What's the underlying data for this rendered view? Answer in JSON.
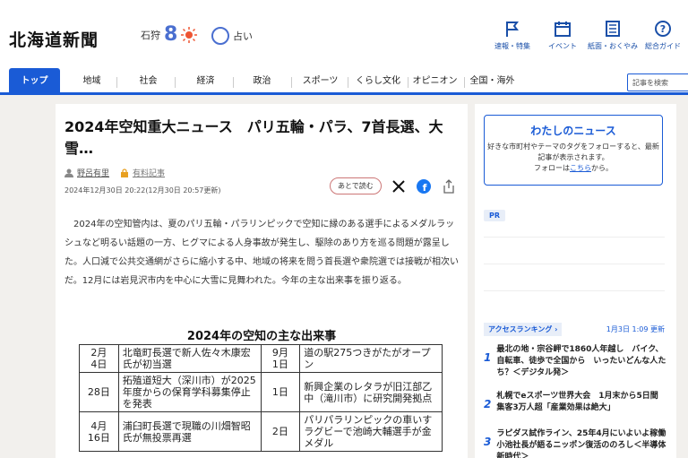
{
  "header": {
    "logo": "北海道新聞",
    "region": "石狩",
    "temp": "8",
    "fortune": "占い",
    "links": [
      "速報・特集",
      "イベント",
      "紙面・おくやみ",
      "総合ガイド"
    ]
  },
  "nav": {
    "items": [
      "トップ",
      "地域",
      "社会",
      "経済",
      "政治",
      "スポーツ",
      "くらし文化",
      "オピニオン",
      "全国・海外"
    ],
    "search_placeholder": "記事を検索"
  },
  "article": {
    "title": "2024年空知重大ニュース　パリ五輪・パラ、7首長選、大雪…",
    "author": "野呂有里",
    "paid": "有料記事",
    "date": "2024年12月30日 20:22(12月30日 20:57更新)",
    "later": "あとで読む",
    "body": "2024年の空知管内は、夏のパリ五輪・パラリンピックで空知に縁のある選手によるメダルラッシュなど明るい話題の一方、ヒグマによる人身事故が発生し、駆除のあり方を巡る問題が露呈した。人口減で公共交通網がさらに縮小する中、地域の将来を問う首長選や衆院選では接戦が相次いだ。12月には岩見沢市内を中心に大雪に見舞われた。今年の主な出来事を振り返る。",
    "table_title": "2024年の空知の主な出来事",
    "rows": [
      {
        "d1": "2月\n4日",
        "e1": "北竜町長選で新人佐々木康宏氏が初当選",
        "d2": "9月\n1日",
        "e2": "道の駅275つきがたがオープン"
      },
      {
        "d1": "28日",
        "e1": "拓殖道短大（深川市）が2025年度からの保育学科募集停止を発表",
        "d2": "1日",
        "e2": "新興企業のレタラが旧江部乙中（滝川市）に研究開発拠点"
      },
      {
        "d1": "4月\n16日",
        "e1": "浦臼町長選で現職の川畑智昭氏が無投票再選",
        "d2": "2日",
        "e2": "パリパラリンピックの車いすラグビーで池崎大輔選手が金メダル"
      }
    ]
  },
  "side": {
    "mynews_title": "わたしのニュース",
    "mynews_text": "好きな市町村やテーマのタグをフォローすると、最新記事が表示されます。",
    "mynews_follow_pre": "フォローは",
    "mynews_follow_link": "こちら",
    "mynews_follow_post": "から。",
    "pr": "PR",
    "ranking_label": "アクセスランキング",
    "ranking_time": "1月3日 1:09 更新",
    "ranking": [
      {
        "n": "1",
        "t": "最北の地・宗谷岬で1860人年越し　バイク、自転車、徒歩で全国から　いったいどんな人たち？＜デジタル発＞"
      },
      {
        "n": "2",
        "t": "札幌でeスポーツ世界大会　1月末から5日間　集客3万人超「産業効果は絶大」"
      },
      {
        "n": "3",
        "t": "ラピダス試作ライン、25年4月にいよいよ稼働　小池社長が語るニッポン復活ののろし＜半導体新時代＞"
      }
    ]
  },
  "colors": {
    "accent": "#1a5bd6"
  }
}
